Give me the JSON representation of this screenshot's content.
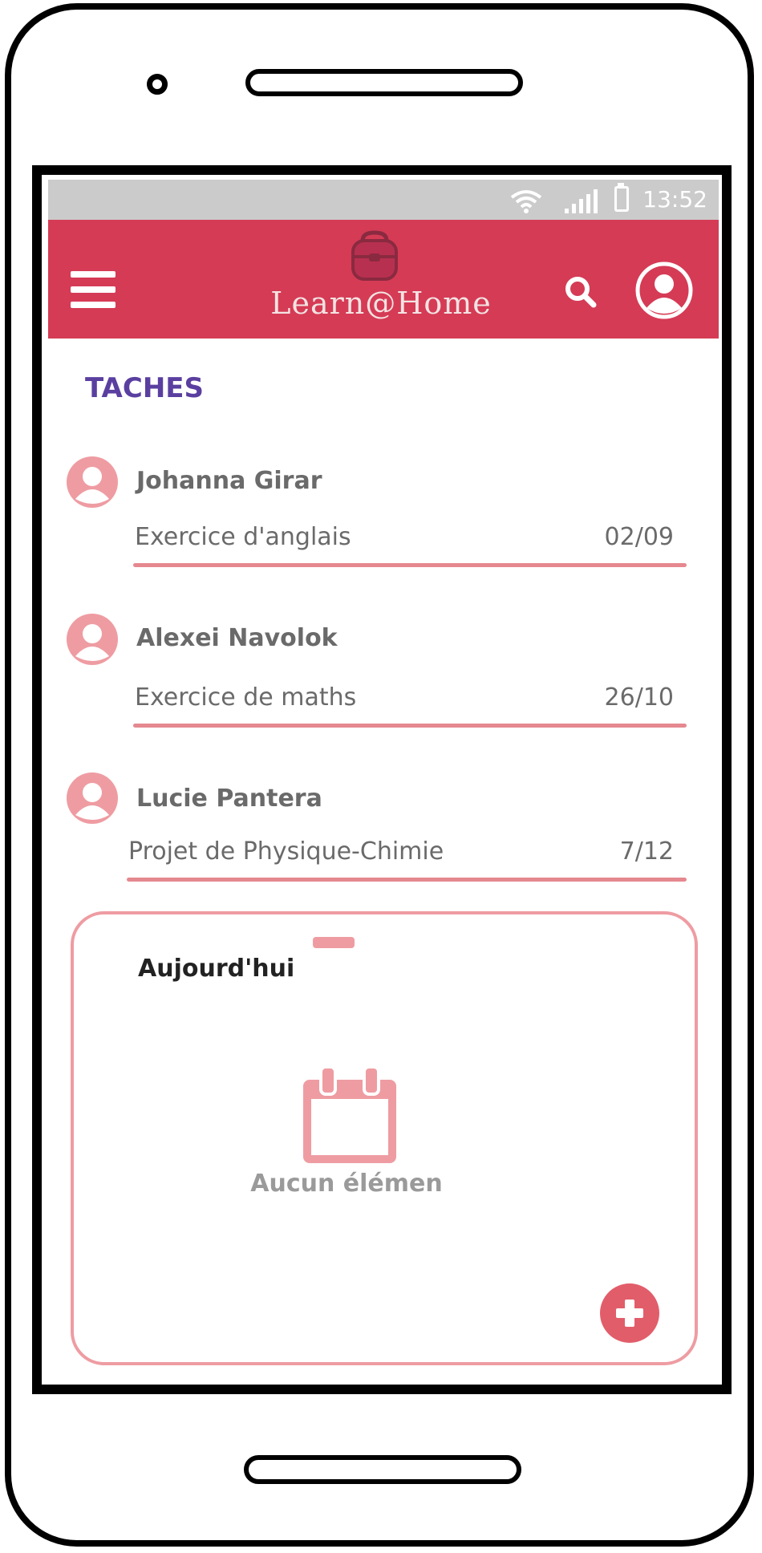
{
  "status_bar": {
    "time": "13:52",
    "icons": [
      "wifi-icon",
      "signal-icon",
      "battery-icon"
    ]
  },
  "app_bar": {
    "title": "Learn@Home",
    "icons": [
      "menu-icon",
      "backpack-logo-icon",
      "search-icon",
      "profile-icon"
    ]
  },
  "section": {
    "title": "TACHES"
  },
  "tasks": [
    {
      "student": "Johanna Girar",
      "label": "Exercice d'anglais",
      "date": "02/09"
    },
    {
      "student": "Alexei Navolok",
      "label": "Exercice de maths",
      "date": "26/10"
    },
    {
      "student": "Lucie Pantera",
      "label": "Projet de Physique-Chimie",
      "date": "7/12"
    }
  ],
  "today": {
    "title": "Aujourd'hui",
    "empty_text": "Aucun élémen",
    "icons": [
      "calendar-icon",
      "add-icon"
    ]
  },
  "colors": {
    "app_bar": "#d53b55",
    "accent_pink": "#ee9ca2",
    "section_title": "#5a3fa0",
    "status_bar": "#cbcbcb",
    "fab": "#e25d6a"
  }
}
